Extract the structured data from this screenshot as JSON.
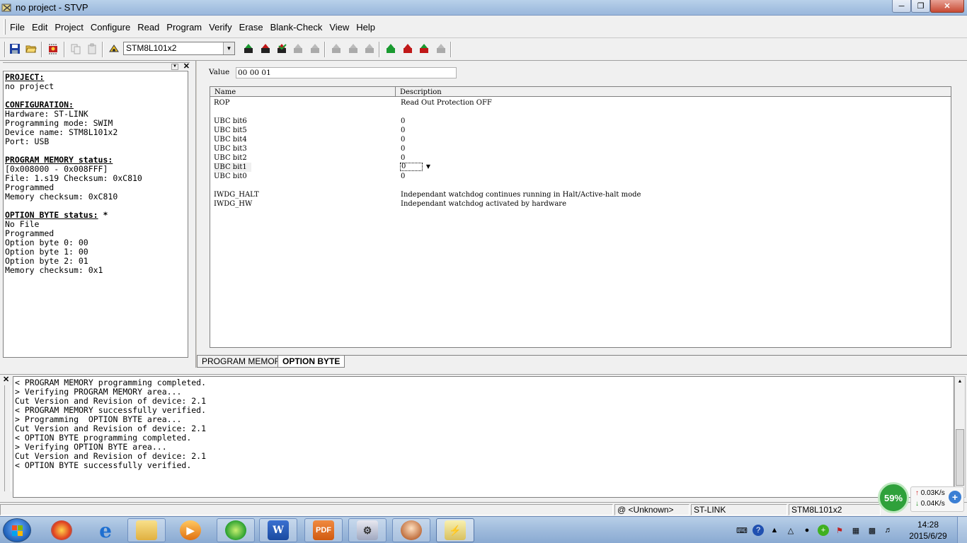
{
  "window": {
    "title": "no project - STVP"
  },
  "menu": [
    "File",
    "Edit",
    "Project",
    "Configure",
    "Read",
    "Program",
    "Verify",
    "Erase",
    "Blank-Check",
    "View",
    "Help"
  ],
  "toolbar": {
    "device": "STM8L101x2"
  },
  "info": {
    "project_h": "PROJECT:",
    "project_v": "no project",
    "config_h": "CONFIGURATION:",
    "config_lines": [
      "Hardware: ST-LINK",
      "Programming mode: SWIM",
      "Device name: STM8L101x2",
      "Port: USB"
    ],
    "progmem_h": "PROGRAM MEMORY status:",
    "progmem_lines": [
      "[0x008000 - 0x008FFF]",
      "File: 1.s19 Checksum: 0xC810",
      "Programmed",
      "Memory checksum: 0xC810"
    ],
    "optbyte_h": "OPTION BYTE status:",
    "optbyte_star": " *",
    "optbyte_lines": [
      "No File",
      "Programmed",
      "Option byte 0: 00",
      "Option byte 1: 00",
      "Option byte 2: 01",
      "Memory checksum: 0x1"
    ]
  },
  "value": {
    "label": "Value",
    "text": "00 00 01"
  },
  "grid": {
    "col_name": "Name",
    "col_desc": "Description",
    "rows": [
      {
        "name": "ROP",
        "desc": "Read Out Protection OFF"
      },
      {
        "name": "",
        "desc": ""
      },
      {
        "name": "UBC bit6",
        "desc": "0"
      },
      {
        "name": "UBC bit5",
        "desc": "0"
      },
      {
        "name": "UBC bit4",
        "desc": "0"
      },
      {
        "name": "UBC bit3",
        "desc": "0"
      },
      {
        "name": "UBC bit2",
        "desc": "0"
      },
      {
        "name": "UBC bit1",
        "desc": "0"
      },
      {
        "name": "UBC bit0",
        "desc": "0"
      },
      {
        "name": "",
        "desc": ""
      },
      {
        "name": "IWDG_HALT",
        "desc": "Independant watchdog continues running in Halt/Active-halt mode"
      },
      {
        "name": "IWDG_HW",
        "desc": "Independant watchdog activated by hardware"
      }
    ]
  },
  "tabs": {
    "program_memory": "PROGRAM MEMORY",
    "option_byte": "OPTION BYTE"
  },
  "log": [
    "< PROGRAM MEMORY programming completed.",
    "> Verifying PROGRAM MEMORY area...",
    "Cut Version and Revision of device: 2.1",
    "< PROGRAM MEMORY successfully verified.",
    "> Programming  OPTION BYTE area...",
    "Cut Version and Revision of device: 2.1",
    "< OPTION BYTE programming completed.",
    "> Verifying OPTION BYTE area...",
    "Cut Version and Revision of device: 2.1",
    "< OPTION BYTE successfully verified."
  ],
  "status": {
    "at": "@ <Unknown>",
    "link": "ST-LINK",
    "device": "STM8L101x2"
  },
  "net": {
    "percent": "59%",
    "up": "0.03K/s",
    "down": "0.04K/s"
  },
  "clock": {
    "time": "14:28",
    "date": "2015/6/29"
  }
}
